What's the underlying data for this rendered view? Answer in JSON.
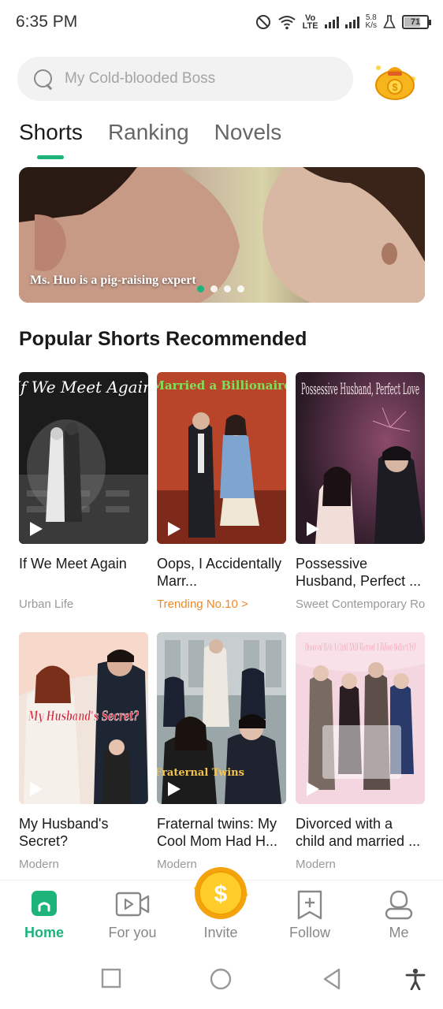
{
  "status_bar": {
    "time": "6:35 PM",
    "net_label_top": "Vo",
    "net_label_bottom": "LTE",
    "speed_top": "5.8",
    "speed_bottom": "K/s",
    "battery": "71",
    "battery_level": 0.71
  },
  "search": {
    "placeholder": "My Cold-blooded Boss"
  },
  "tabs": [
    {
      "label": "Shorts",
      "active": true
    },
    {
      "label": "Ranking",
      "active": false
    },
    {
      "label": "Novels",
      "active": false
    }
  ],
  "banner": {
    "caption": "Ms. Huo is a pig-raising expert",
    "active_dot": 0,
    "dot_count": 4
  },
  "section": {
    "title": "Popular Shorts Recommended"
  },
  "cards": [
    {
      "title": "If We Meet Again",
      "subtitle": "Urban Life",
      "poster_text": "If We Meet Again"
    },
    {
      "title": "Oops, I Accidentally Marr...",
      "subtitle": "Trending No.10 >",
      "poster_text": "Married a Billionaire"
    },
    {
      "title": "Possessive Husband, Perfect ...",
      "subtitle": "Sweet Contemporary Ro",
      "poster_text": "Possessive Husband, Perfect Love"
    },
    {
      "title": "My Husband's Secret?",
      "subtitle": "Modern",
      "poster_text": "My Husband's Secret?"
    },
    {
      "title": "Fraternal twins: My Cool Mom Had H...",
      "subtitle": "Modern",
      "poster_text": "Fraternal Twins"
    },
    {
      "title": "Divorced with a child and married ...",
      "subtitle": "Modern",
      "poster_text": "Divorced With A Child AND Married A Billion-Dollar CEO"
    }
  ],
  "bottom_nav": [
    {
      "label": "Home",
      "icon": "home-icon",
      "active": true
    },
    {
      "label": "For you",
      "icon": "video-icon",
      "active": false
    },
    {
      "label": "Invite",
      "icon": "coin-icon",
      "active": false
    },
    {
      "label": "Follow",
      "icon": "bookmark-add-icon",
      "active": false
    },
    {
      "label": "Me",
      "icon": "profile-icon",
      "active": false
    }
  ],
  "colors": {
    "accent": "#1db37a",
    "trending": "#f08a24"
  }
}
